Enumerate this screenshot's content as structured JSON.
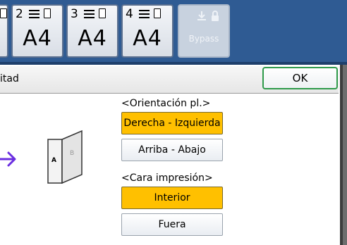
{
  "trays": [
    {
      "number": "",
      "size": ""
    },
    {
      "number": "2",
      "size": "A4"
    },
    {
      "number": "3",
      "size": "A4"
    },
    {
      "number": "4",
      "size": "A4"
    }
  ],
  "bypass": {
    "label": "Bypass"
  },
  "title": {
    "text": "itad"
  },
  "ok_button": {
    "label": "OK"
  },
  "orientation": {
    "label": "<Orientación pl.>",
    "options": [
      "Derecha - Izquierda",
      "Arriba - Abajo"
    ],
    "selected": "Derecha - Izquierda"
  },
  "print_side": {
    "label": "<Cara impresión>",
    "options": [
      "Interior",
      "Fuera"
    ],
    "selected": "Interior"
  },
  "booklet": {
    "page_a": "A",
    "page_b": "B"
  },
  "colors": {
    "topbar": "#2f5b93",
    "selected": "#ffc000",
    "ok_border": "#2e9a4a",
    "arrow": "#6a2ee0"
  }
}
